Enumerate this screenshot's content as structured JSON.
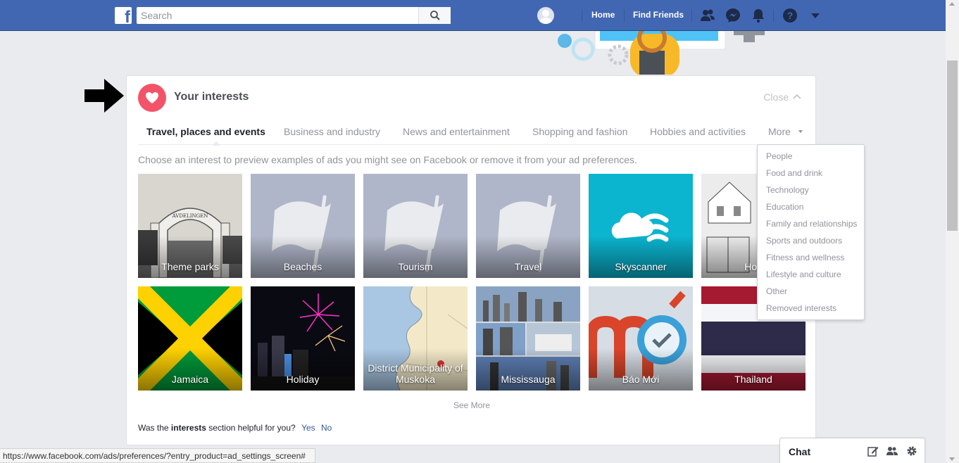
{
  "topbar": {
    "search_placeholder": "Search",
    "home": "Home",
    "find_friends": "Find Friends"
  },
  "card": {
    "title": "Your interests",
    "close": "Close",
    "tabs": [
      {
        "label": "Travel, places and events"
      },
      {
        "label": "Business and industry"
      },
      {
        "label": "News and entertainment"
      },
      {
        "label": "Shopping and fashion"
      },
      {
        "label": "Hobbies and activities"
      },
      {
        "label": "More"
      }
    ],
    "intro": "Choose an interest to preview examples of ads you might see on Facebook or remove it from your ad preferences.",
    "tiles": [
      {
        "label": "Theme parks"
      },
      {
        "label": "Beaches"
      },
      {
        "label": "Tourism"
      },
      {
        "label": "Travel"
      },
      {
        "label": "Skyscanner"
      },
      {
        "label": "Hon"
      },
      {
        "label": "Jamaica"
      },
      {
        "label": "Holiday"
      },
      {
        "label": "District Municipality of Muskoka"
      },
      {
        "label": "Mississauga"
      },
      {
        "label": "Báo Mới"
      },
      {
        "label": "Thailand"
      }
    ],
    "see_more": "See More",
    "helpful_pre": "Was the",
    "helpful_bold": "interests",
    "helpful_post": "section helpful for you?",
    "yes": "Yes",
    "no": "No"
  },
  "dropdown": {
    "items": [
      "People",
      "Food and drink",
      "Technology",
      "Education",
      "Family and relationships",
      "Sports and outdoors",
      "Fitness and wellness",
      "Lifestyle and culture",
      "Other",
      "Removed interests"
    ]
  },
  "statusbar": {
    "url": "https://www.facebook.com/ads/preferences/?entry_product=ad_settings_screen#"
  },
  "chat": {
    "label": "Chat"
  },
  "colors": {
    "brand": "#4267b2",
    "heart": "#f35369",
    "link": "#365899"
  }
}
